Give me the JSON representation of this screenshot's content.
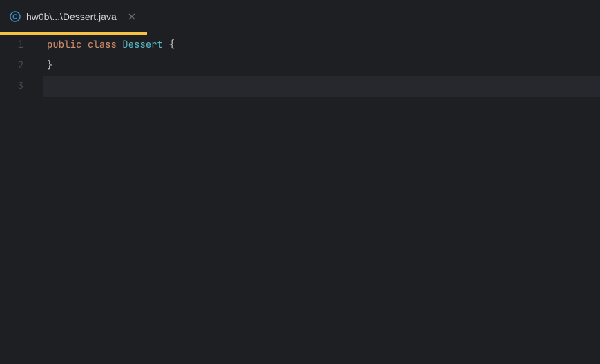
{
  "tab": {
    "label": "hw0b\\...\\Dessert.java",
    "icon_name": "class-file-icon"
  },
  "code": {
    "lines": [
      {
        "num": "1",
        "segments": [
          {
            "t": "public",
            "c": "kw"
          },
          {
            "t": " ",
            "c": ""
          },
          {
            "t": "class",
            "c": "kw"
          },
          {
            "t": " ",
            "c": ""
          },
          {
            "t": "Dessert",
            "c": "cls"
          },
          {
            "t": " ",
            "c": ""
          },
          {
            "t": "{",
            "c": "brace"
          }
        ]
      },
      {
        "num": "2",
        "segments": [
          {
            "t": "}",
            "c": "brace"
          }
        ]
      },
      {
        "num": "3",
        "segments": [],
        "current": true
      }
    ]
  }
}
